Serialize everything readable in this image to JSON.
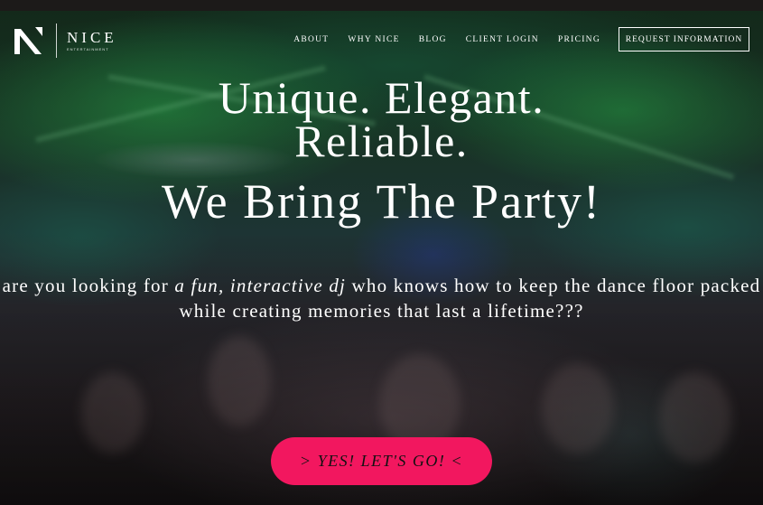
{
  "brand": {
    "name": "NICE",
    "subtitle": "ENTERTAINMENT"
  },
  "nav": {
    "items": [
      {
        "label": "ABOUT"
      },
      {
        "label": "WHY NICE"
      },
      {
        "label": "BLOG"
      },
      {
        "label": "CLIENT LOGIN"
      },
      {
        "label": "PRICING"
      }
    ],
    "cta_label": "REQUEST INFORMATION"
  },
  "hero": {
    "headline_line1": "Unique. Elegant.",
    "headline_line2": "Reliable.",
    "headline_line3": "We Bring The Party!",
    "sub_part1": "are you looking for",
    "sub_emphasis": "a fun, interactive dj",
    "sub_part2": "who knows how to keep the dance floor packed while creating memories that last a lifetime???",
    "button_label": "> YES! LET'S GO! <"
  },
  "colors": {
    "accent": "#f2175f",
    "text": "#ffffff",
    "top_strip": "#1c1a19"
  },
  "icons": {
    "logo": "n-logo-mark"
  }
}
